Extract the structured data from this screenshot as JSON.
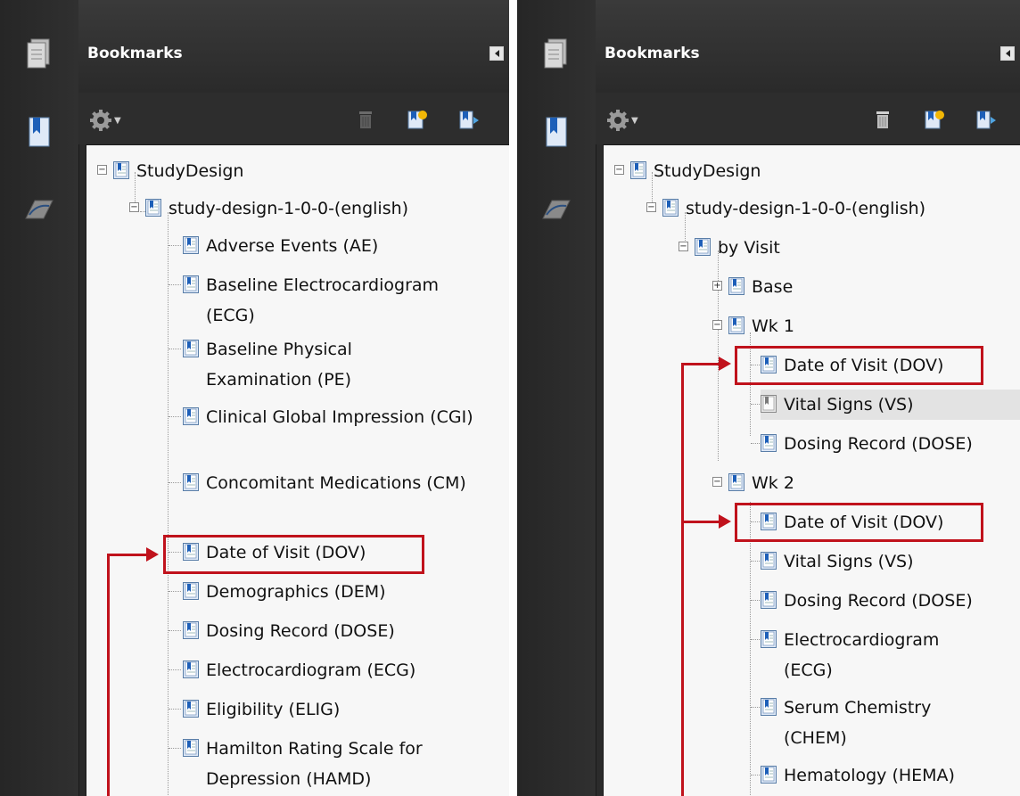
{
  "panels": [
    {
      "header_title": "Bookmarks",
      "items": [
        {
          "label": "StudyDesign"
        },
        {
          "label": "study-design-1-0-0-(english)"
        },
        {
          "label": "Adverse Events (AE)"
        },
        {
          "label": "Baseline Electrocardiogram (ECG)"
        },
        {
          "label": "Baseline Physical Examination (PE)"
        },
        {
          "label": "Clinical Global Impression (CGI)"
        },
        {
          "label": "Concomitant Medications (CM)"
        },
        {
          "label": "Date of Visit (DOV)"
        },
        {
          "label": "Demographics (DEM)"
        },
        {
          "label": "Dosing Record (DOSE)"
        },
        {
          "label": "Electrocardiogram (ECG)"
        },
        {
          "label": "Eligibility (ELIG)"
        },
        {
          "label": "Hamilton Rating Scale for Depression (HAMD)"
        }
      ]
    },
    {
      "header_title": "Bookmarks",
      "items": [
        {
          "label": "StudyDesign"
        },
        {
          "label": "study-design-1-0-0-(english)"
        },
        {
          "label": "by Visit"
        },
        {
          "label": "Base"
        },
        {
          "label": "Wk 1"
        },
        {
          "label": "Date of Visit (DOV)"
        },
        {
          "label": "Vital Signs (VS)"
        },
        {
          "label": "Dosing Record (DOSE)"
        },
        {
          "label": "Wk 2"
        },
        {
          "label": "Date of Visit (DOV)"
        },
        {
          "label": "Vital Signs (VS)"
        },
        {
          "label": "Dosing Record (DOSE)"
        },
        {
          "label": "Electrocardiogram (ECG)"
        },
        {
          "label": "Serum Chemistry (CHEM)"
        },
        {
          "label": "Hematology (HEMA)"
        }
      ]
    }
  ],
  "colors": {
    "highlight_red": "#c0121c",
    "panel_dark": "#2b2b2b",
    "tree_bg": "#f7f7f7",
    "bookmark_blue": "#1d5fb8"
  },
  "icons": [
    "pages-icon",
    "bookmarks-icon",
    "signatures-icon",
    "gear-icon",
    "delete-icon",
    "new-bookmark-icon",
    "expand-bookmark-icon",
    "bookmark-icon"
  ]
}
